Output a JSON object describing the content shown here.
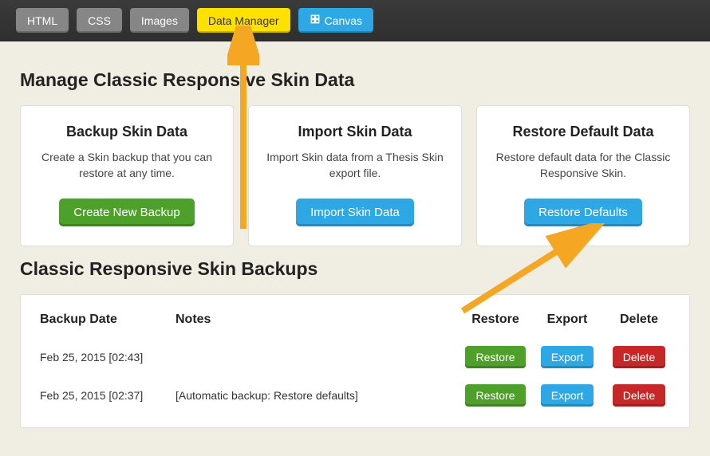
{
  "topbar": {
    "tabs": [
      "HTML",
      "CSS",
      "Images",
      "Data Manager",
      "Canvas"
    ],
    "active": "Data Manager"
  },
  "headings": {
    "manage": "Manage Classic Responsive Skin Data",
    "backups": "Classic Responsive Skin Backups"
  },
  "cards": {
    "backup": {
      "title": "Backup Skin Data",
      "desc": "Create a Skin backup that you can restore at any time.",
      "button": "Create New Backup"
    },
    "import": {
      "title": "Import Skin Data",
      "desc": "Import Skin data from a Thesis Skin export file.",
      "button": "Import Skin Data"
    },
    "restore": {
      "title": "Restore Default Data",
      "desc": "Restore default data for the Classic Responsive Skin.",
      "button": "Restore Defaults"
    }
  },
  "table": {
    "headers": {
      "date": "Backup Date",
      "notes": "Notes",
      "restore": "Restore",
      "export": "Export",
      "delete": "Delete"
    },
    "rows": [
      {
        "date": "Feb 25, 2015 [02:43]",
        "notes": "",
        "restore": "Restore",
        "export": "Export",
        "delete": "Delete"
      },
      {
        "date": "Feb 25, 2015 [02:37]",
        "notes": "[Automatic backup: Restore defaults]",
        "restore": "Restore",
        "export": "Export",
        "delete": "Delete"
      }
    ]
  },
  "colors": {
    "green": "#4da02a",
    "blue": "#2ea8e5",
    "red": "#c62828",
    "yellow": "#ffe100",
    "arrow": "#f5a623"
  }
}
